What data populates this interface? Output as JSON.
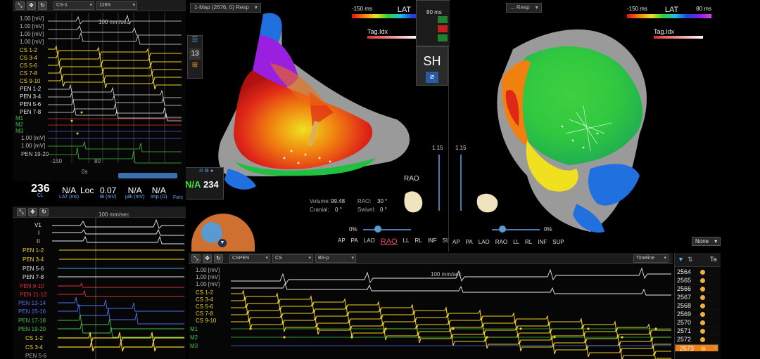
{
  "ecg_top": {
    "selectors": [
      "CS-1",
      "128S"
    ],
    "speed": "100 mm/sec",
    "mv_labels": [
      "1.00 [mV]",
      "1.00 [mV]",
      "1.00 [mV]",
      "1.00 [mV]",
      "1.00 [mV]"
    ],
    "channel_labels": [
      "CS 1-2",
      "CS 3-4",
      "CS 5-6",
      "CS 7-8",
      "CS 9-10",
      "PEN 1-2",
      "PEN 3-4",
      "PEN 5-6",
      "PEN 7-8",
      "M1",
      "M2",
      "M3"
    ],
    "bottom_labels": [
      "1.00 [mV]",
      "1.00 [mV]",
      "PEN 19-20"
    ],
    "scale_left": "-150",
    "scale_mid": "0s",
    "scale_right": "80"
  },
  "stats": {
    "cl_value": "236",
    "cl_label": "CL",
    "lat_value": "N/A",
    "lat_label": "LAT (ms)",
    "loc_value": "Loc",
    "bi_value": "0.07",
    "bi_label": "Bi (mV)",
    "ubi_value": "N/A",
    "ubi_label": "µBi (mV)",
    "imp_value": "N/A",
    "imp_label": "Imp (Ω)",
    "force_label": "Forc"
  },
  "ecg_left": {
    "speed": "100 mm/sec",
    "labels": [
      "V1",
      "I",
      "II",
      "PEN 1-2",
      "PEN 3-4",
      "PEN 5-6",
      "PEN 7-8",
      "PEN 9-10",
      "PEN 11-12",
      "PEN 13-14",
      "PEN 15-16",
      "PEN 17-18",
      "PEN 19-20",
      "CS 1-2",
      "CS 3-4",
      "PEN 5-6"
    ]
  },
  "map_left": {
    "title": "1-Map (2676, 0) Resp",
    "lat_min": "-150 ms",
    "lat_label": "LAT",
    "tag_label": "Tag.Idx",
    "side_number": "13",
    "na_value": "N/A",
    "na_number": "234",
    "volume_label": "Volume:",
    "volume_value": "99.48",
    "rao_label": "RAO:",
    "rao_value": "30 °",
    "cranial_label": "Cranial:",
    "cranial_value": "0 °",
    "swivel_label": "Swivel:",
    "swivel_value": "0 °",
    "view_label": "RAO",
    "slider_top": "1.15",
    "percent": "0%",
    "orient": [
      "AP",
      "PA",
      "LAO",
      "RAO",
      "LL",
      "RL",
      "INF",
      "SUP"
    ],
    "orient_active": "RAO"
  },
  "map_right": {
    "title": "... Resp",
    "lat_min": "-150 ms",
    "lat_label": "LAT",
    "lat_max": "80 ms",
    "tag_label": "Tag.Idx",
    "slider_top": "1.15",
    "percent": "0%",
    "orient": [
      "AP",
      "PA",
      "LAO",
      "RAO",
      "LL",
      "RL",
      "INF",
      "SUP"
    ],
    "dropdown": "None"
  },
  "overlay": {
    "sh_label": "SH",
    "ms_text": "80 ms"
  },
  "ecg_bottom": {
    "selectors": [
      "CSPEN",
      "CS",
      "BS-p"
    ],
    "timeline": "Timeline",
    "speed": "100 mm/sec",
    "mv_labels": [
      "1.00 [mV]",
      "1.00 [mV]",
      "1.00 [mV]"
    ],
    "channel_labels": [
      "CS 1-2",
      "CS 3-4",
      "CS 5-6",
      "CS 7-8",
      "CS 9-10",
      "M1",
      "M2",
      "M3"
    ]
  },
  "point_list": {
    "header_col": "Ta",
    "rows": [
      "2564",
      "2565",
      "2566",
      "2567",
      "2568",
      "2569",
      "2570",
      "2571",
      "2572",
      "2573"
    ],
    "selected": "2573"
  },
  "colors": {
    "trace_yellow": "#f0d020",
    "trace_white": "#e8e8e8",
    "trace_red": "#e03030",
    "trace_blue": "#4060e0",
    "trace_green": "#40c040",
    "accent_orange": "#f08010"
  }
}
